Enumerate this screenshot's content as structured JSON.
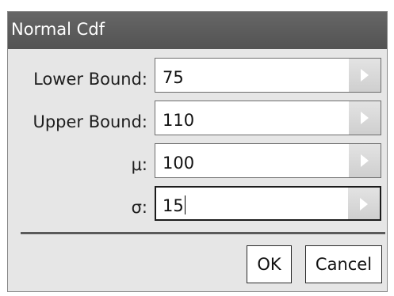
{
  "dialog": {
    "title": "Normal Cdf"
  },
  "fields": [
    {
      "label": "Lower Bound:",
      "value": "75",
      "focused": false
    },
    {
      "label": "Upper Bound:",
      "value": "110",
      "focused": false
    },
    {
      "label": "μ:",
      "value": "100",
      "focused": false
    },
    {
      "label": "σ:",
      "value": "15",
      "focused": true
    }
  ],
  "buttons": {
    "ok_label": "OK",
    "cancel_label": "Cancel"
  },
  "icons": {
    "field_dropdown": "triangle-right-icon"
  }
}
